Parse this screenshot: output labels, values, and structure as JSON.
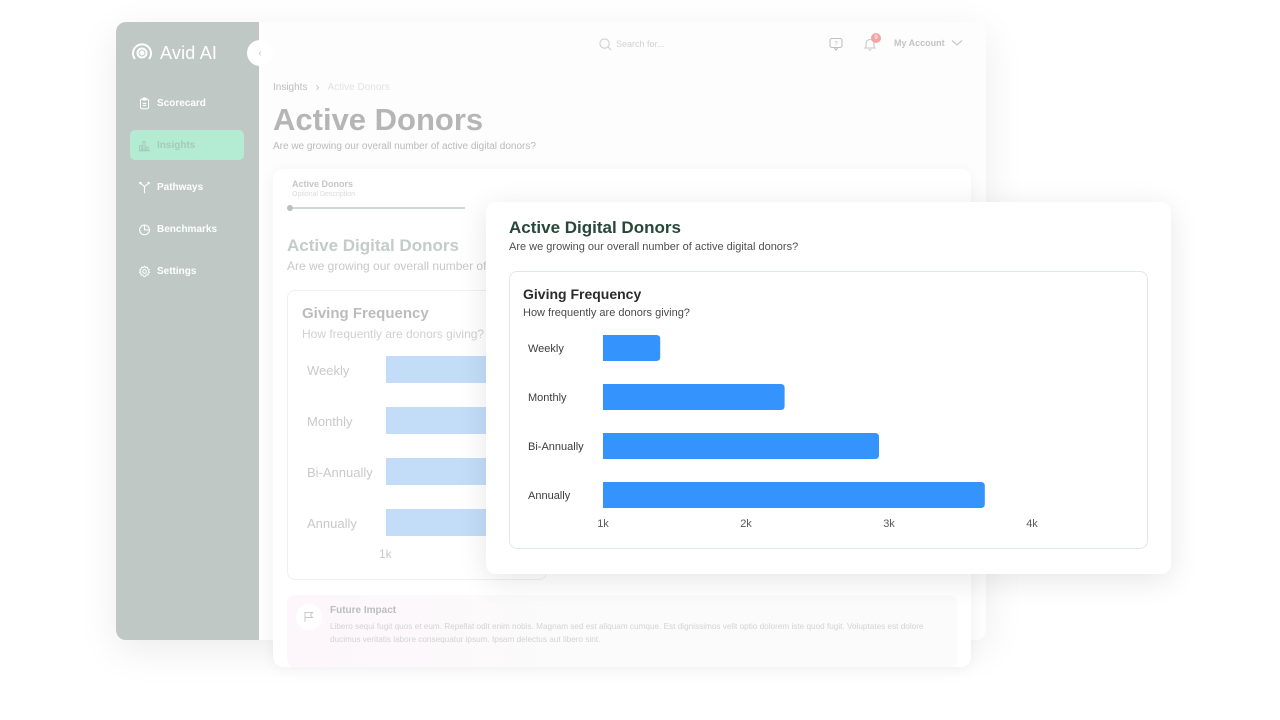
{
  "app": {
    "logo_text": "Avid AI",
    "collapse_icon": "chevron-left-icon"
  },
  "sidebar": {
    "items": [
      {
        "label": "Scorecard",
        "icon": "clipboard-icon",
        "active": false
      },
      {
        "label": "Insights",
        "icon": "bar-chart-icon",
        "active": true
      },
      {
        "label": "Pathways",
        "icon": "branch-icon",
        "active": false
      },
      {
        "label": "Benchmarks",
        "icon": "pie-chart-icon",
        "active": false
      },
      {
        "label": "Settings",
        "icon": "gear-icon",
        "active": false
      }
    ]
  },
  "topbar": {
    "search_placeholder": "Search for...",
    "notification_count": "9",
    "account_label": "My Account"
  },
  "breadcrumb": {
    "items": [
      "Insights",
      "Active Donors"
    ]
  },
  "page": {
    "title": "Active Donors",
    "subtitle": "Are we growing our overall number of active digital donors?"
  },
  "tab": {
    "title": "Active Donors",
    "description": "Optional Description"
  },
  "background_section": {
    "title": "Active Digital Donors",
    "subtitle": "Are we growing our overall number of active digital donors?",
    "chart_title": "Giving Frequency",
    "chart_subtitle": "How frequently are donors giving?",
    "row_labels": [
      "Weekly",
      "Monthly",
      "Bi-Annually",
      "Annually"
    ],
    "tick_label": "1k"
  },
  "future_impact": {
    "title": "Future Impact",
    "text": "Libero sequi fugit quos et eum. Repellat odit enim nobis. Magnam sed est aliquam cumque. Est dignissimos velit optio dolorem iste quod fugit. Voluptates est dolore ducimus veritatis labore consequatur ipsum. Ipsam delectus aut libero sint."
  },
  "foreground": {
    "title": "Active Digital Donors",
    "subtitle": "Are we growing our overall number of active digital donors?"
  },
  "colors": {
    "sidebar_bg": "#bfc8c4",
    "active_nav_bg": "#b4ebd3",
    "bar_color": "#3593fd",
    "bar_color_faded": "#c3ddf9",
    "title_green": "#27473a",
    "badge_red": "#f4a3a3"
  },
  "chart_data": {
    "type": "bar",
    "orientation": "horizontal",
    "title": "Giving Frequency",
    "subtitle": "How frequently are donors giving?",
    "categories": [
      "Weekly",
      "Monthly",
      "Bi-Annually",
      "Annually"
    ],
    "values": [
      1400,
      2270,
      2930,
      3670
    ],
    "xlabel": "",
    "ylabel": "",
    "xlim": [
      1000,
      4000
    ],
    "x_ticks": [
      1000,
      2000,
      3000,
      4000
    ],
    "x_tick_labels": [
      "1k",
      "2k",
      "3k",
      "4k"
    ],
    "grid": false,
    "legend": "none"
  }
}
